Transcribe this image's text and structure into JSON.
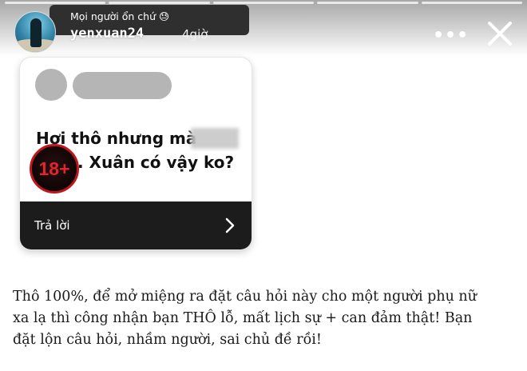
{
  "story": {
    "reply_snippet": "Mọi người ổn chứ 😓",
    "username": "yenxuan24",
    "time": "4giờ",
    "more_icon": "more-horizontal-icon",
    "close_icon": "close-icon"
  },
  "question_card": {
    "question_line1": "Hơi thô nhưng mà",
    "question_line2": ". Xuân có vậy ko?",
    "age_badge": "18+",
    "reply_label": "Trả lời",
    "chevron_icon": "chevron-right-icon"
  },
  "caption": {
    "lines": [
      "Thô 100%, để mở miệng ra đặt câu hỏi này cho một người phụ nữ",
      "xa lạ thì công nhận bạn THÔ lỗ, mất lịch sự + can đảm thật! Bạn",
      "đặt lộn câu hỏi, nhầm người, sai chủ đề rồi!"
    ]
  },
  "colors": {
    "age_badge_red": "#e0252c",
    "reply_bar": "#1c1c1c"
  }
}
